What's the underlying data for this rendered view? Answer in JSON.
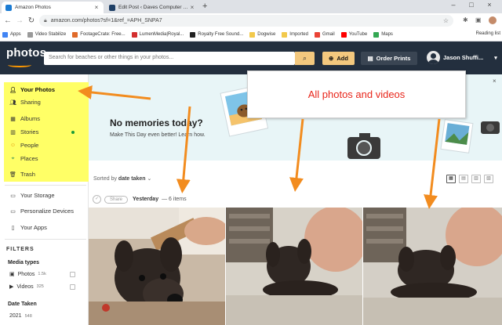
{
  "browser": {
    "tabs": [
      {
        "title": "Amazon Photos",
        "active": true
      },
      {
        "title": "Edit Post ‹ Daves Computer Tips",
        "active": false
      }
    ],
    "new_tab": "+",
    "url": "amazon.com/photos?sf=1&ref_=APH_SNPA7",
    "bookmarks": [
      "Apps",
      "Video Stabilize",
      "FootageCrate: Free...",
      "LumenMedia|Royal...",
      "Royalty Free Sound...",
      "Dogwise",
      "Imported",
      "Gmail",
      "YouTube",
      "Maps"
    ],
    "reading_list": "Reading list"
  },
  "header": {
    "logo": "photos",
    "search_placeholder": "Search for beaches or other things in your photos...",
    "add_label": "Add",
    "order_prints_label": "Order Prints",
    "user_name": "Jason Shuffi..."
  },
  "sidebar": {
    "primary": [
      {
        "label": "Your Photos",
        "icon": "person-icon"
      },
      {
        "label": "Sharing",
        "icon": "people-icon"
      },
      {
        "label": "Albums",
        "icon": "album-icon"
      },
      {
        "label": "Stories",
        "icon": "stories-icon"
      },
      {
        "label": "People",
        "icon": "smile-icon"
      },
      {
        "label": "Places",
        "icon": "pin-icon"
      },
      {
        "label": "Trash",
        "icon": "trash-icon"
      }
    ],
    "secondary": [
      {
        "label": "Your Storage",
        "icon": "storage-icon"
      },
      {
        "label": "Personalize Devices",
        "icon": "device-icon"
      },
      {
        "label": "Your Apps",
        "icon": "phone-icon"
      }
    ],
    "filters_title": "FILTERS",
    "media_types_title": "Media types",
    "media_types": [
      {
        "label": "Photos",
        "count": "1.5k"
      },
      {
        "label": "Videos",
        "count": "325"
      }
    ],
    "date_taken_title": "Date Taken",
    "date_taken": [
      {
        "label": "2021",
        "count": "548"
      }
    ]
  },
  "memories": {
    "title": "No memories today?",
    "subtitle": "Make This Day even better! Learn how."
  },
  "annotation": {
    "text": "All photos and videos",
    "color": "#e8261b",
    "arrow_color": "#f28c1f",
    "highlight_color": "#ffff66"
  },
  "content": {
    "sort_prefix": "Sorted by",
    "sort_value": "date taken",
    "share_label": "Share",
    "date_label": "Yesterday",
    "date_count": "— 6 items"
  },
  "colors": {
    "header_bg": "#232f3e",
    "accent": "#ff9900",
    "button_bg": "#f3c87e"
  }
}
